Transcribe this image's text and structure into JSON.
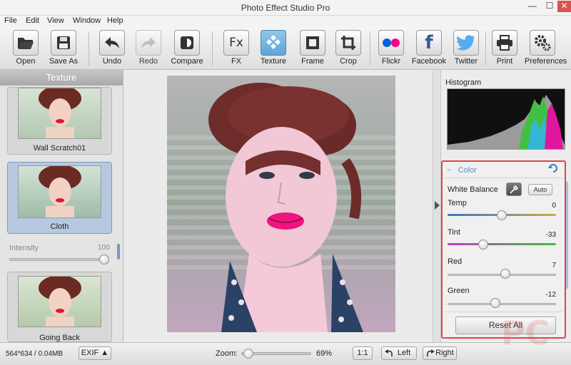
{
  "window": {
    "title": "Photo Effect Studio Pro",
    "min": "—",
    "max": "☐",
    "close": "✕"
  },
  "menu": [
    "File",
    "Edit",
    "View",
    "Window",
    "Help"
  ],
  "toolbar": {
    "open": "Open",
    "save_as": "Save As",
    "undo": "Undo",
    "redo": "Redo",
    "compare": "Compare",
    "fx": "FX",
    "texture": "Texture",
    "frame": "Frame",
    "crop": "Crop",
    "flickr": "Flickr",
    "facebook": "Facebook",
    "twitter": "Twitter",
    "print": "Print",
    "preferences": "Preferences",
    "fx_glyph": "Fx",
    "facebook_glyph": "f"
  },
  "left_panel": {
    "title": "Texture",
    "items": [
      {
        "label": "Wall Scratch01"
      },
      {
        "label": "Cloth"
      },
      {
        "label": "Going Back"
      }
    ],
    "intensity_label": "Intensity",
    "intensity_value": "100"
  },
  "right_panel": {
    "histogram_label": "Histogram",
    "section_title": "Color",
    "collapse_glyph": "−",
    "white_balance_label": "White Balance",
    "auto_label": "Auto",
    "sliders": [
      {
        "label": "Temp",
        "value": "0",
        "fraction": 0.5
      },
      {
        "label": "Tint",
        "value": "-33",
        "fraction": 0.33
      },
      {
        "label": "Red",
        "value": "7",
        "fraction": 0.535
      },
      {
        "label": "Green",
        "value": "-12",
        "fraction": 0.44
      }
    ],
    "reset_label": "Reset All"
  },
  "status": {
    "dimensions": "564*634 / 0.04MB",
    "exif_label": "EXIF ▲",
    "zoom_label": "Zoom:",
    "zoom_value": "69%",
    "zoom_fraction": 0.1,
    "one_to_one": "1:1",
    "rotate_left": "Left",
    "rotate_right": "Right"
  },
  "colors": {
    "accent": "#5da6d6",
    "highlight_border": "#e24444",
    "section_title": "#5c8fc6"
  }
}
